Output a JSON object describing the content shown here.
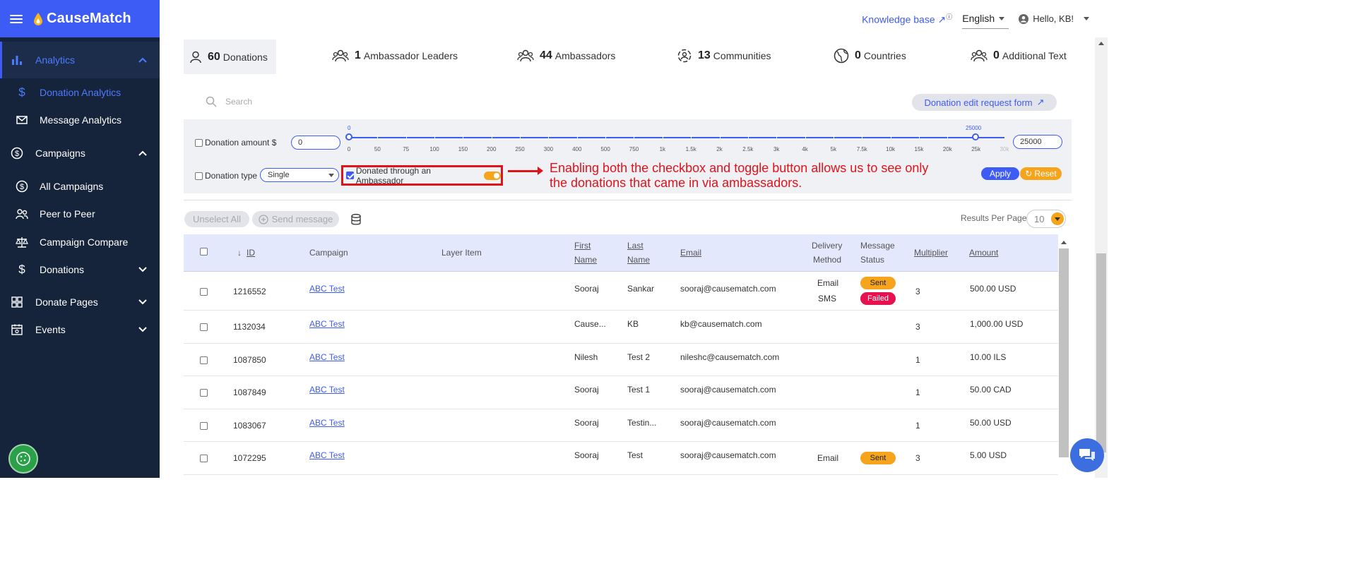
{
  "brand": {
    "name": "CauseMatch"
  },
  "header": {
    "knowledge_base": "Knowledge base",
    "language": "English",
    "user": "Hello, KB!"
  },
  "sidebar": {
    "analytics": "Analytics",
    "donation_analytics": "Donation Analytics",
    "message_analytics": "Message Analytics",
    "campaigns": "Campaigns",
    "all_campaigns": "All Campaigns",
    "peer_to_peer": "Peer to Peer",
    "campaign_compare": "Campaign Compare",
    "donations": "Donations",
    "donate_pages": "Donate Pages",
    "events": "Events"
  },
  "stats": [
    {
      "count": "60",
      "label": "Donations"
    },
    {
      "count": "1",
      "label": "Ambassador Leaders"
    },
    {
      "count": "44",
      "label": "Ambassadors"
    },
    {
      "count": "13",
      "label": "Communities"
    },
    {
      "count": "0",
      "label": "Countries"
    },
    {
      "count": "0",
      "label": "Additional Text"
    }
  ],
  "search": {
    "placeholder": "Search"
  },
  "edit_request": "Donation edit request form",
  "filters": {
    "amount_label": "Donation amount $",
    "amount_min": "0",
    "amount_max": "25000",
    "slider_min_label": "0",
    "slider_max_label": "25000",
    "ticks": [
      "0",
      "50",
      "75",
      "100",
      "150",
      "200",
      "250",
      "300",
      "400",
      "500",
      "750",
      "1k",
      "1.5k",
      "2k",
      "2.5k",
      "3k",
      "4k",
      "5k",
      "7.5k",
      "10k",
      "15k",
      "20k",
      "25k",
      "30k"
    ],
    "type_label": "Donation type",
    "type_value": "Single",
    "ambassador_label": "Donated through an Ambassador",
    "apply": "Apply",
    "reset": "Reset"
  },
  "annotation": "Enabling both the checkbox and toggle button allows us to see only the donations that came in via ambassadors.",
  "actions": {
    "unselect_all": "Unselect All",
    "send_message": "Send message",
    "results_per_page": "Results Per Page",
    "results_value": "10"
  },
  "table": {
    "headers": {
      "id": "ID",
      "campaign": "Campaign",
      "layer_item": "Layer Item",
      "first_name_1": "First",
      "first_name_2": "Name",
      "last_name_1": "Last",
      "last_name_2": "Name",
      "email": "Email",
      "delivery_1": "Delivery",
      "delivery_2": "Method",
      "message_1": "Message",
      "message_2": "Status",
      "multiplier": "Multiplier",
      "amount": "Amount"
    },
    "rows": [
      {
        "id": "1216552",
        "campaign": "ABC Test",
        "first": "Sooraj",
        "last": "Sankar",
        "email": "sooraj@causematch.com",
        "delivery1": "Email",
        "delivery2": "SMS",
        "status1": "Sent",
        "status2": "Failed",
        "multiplier": "3",
        "amount": "500.00 USD"
      },
      {
        "id": "1132034",
        "campaign": "ABC Test",
        "first": "Cause...",
        "last": "KB",
        "email": "kb@causematch.com",
        "delivery1": "",
        "delivery2": "",
        "status1": "",
        "status2": "",
        "multiplier": "3",
        "amount": "1,000.00 USD"
      },
      {
        "id": "1087850",
        "campaign": "ABC Test",
        "first": "Nilesh",
        "last": "Test 2",
        "email": "nileshc@causematch.com",
        "delivery1": "",
        "delivery2": "",
        "status1": "",
        "status2": "",
        "multiplier": "1",
        "amount": "10.00 ILS"
      },
      {
        "id": "1087849",
        "campaign": "ABC Test",
        "first": "Sooraj",
        "last": "Test 1",
        "email": "sooraj@causematch.com",
        "delivery1": "",
        "delivery2": "",
        "status1": "",
        "status2": "",
        "multiplier": "1",
        "amount": "50.00 CAD"
      },
      {
        "id": "1083067",
        "campaign": "ABC Test",
        "first": "Sooraj",
        "last": "Testin...",
        "email": "sooraj@causematch.com",
        "delivery1": "",
        "delivery2": "",
        "status1": "",
        "status2": "",
        "multiplier": "1",
        "amount": "50.00 USD"
      },
      {
        "id": "1072295",
        "campaign": "ABC Test",
        "first": "Sooraj",
        "last": "Test",
        "email": "sooraj@causematch.com",
        "delivery1": "Email",
        "delivery2": "",
        "status1": "Sent",
        "status2": "",
        "multiplier": "3",
        "amount": "5.00 USD"
      }
    ]
  },
  "colors": {
    "brand": "#3d5cf5",
    "sidebar": "#15233b",
    "accent_orange": "#f5a41c",
    "annotation_red": "#e0131b",
    "failed_red": "#e5124f"
  },
  "icons": [
    "menu-icon",
    "analytics-icon",
    "dollar-icon",
    "mail-icon",
    "campaigns-icon",
    "peer-icon",
    "compare-icon",
    "donate-pages-icon",
    "events-icon",
    "user-icon",
    "search-icon",
    "external-link-icon",
    "database-icon",
    "chat-icon",
    "cookie-icon"
  ]
}
